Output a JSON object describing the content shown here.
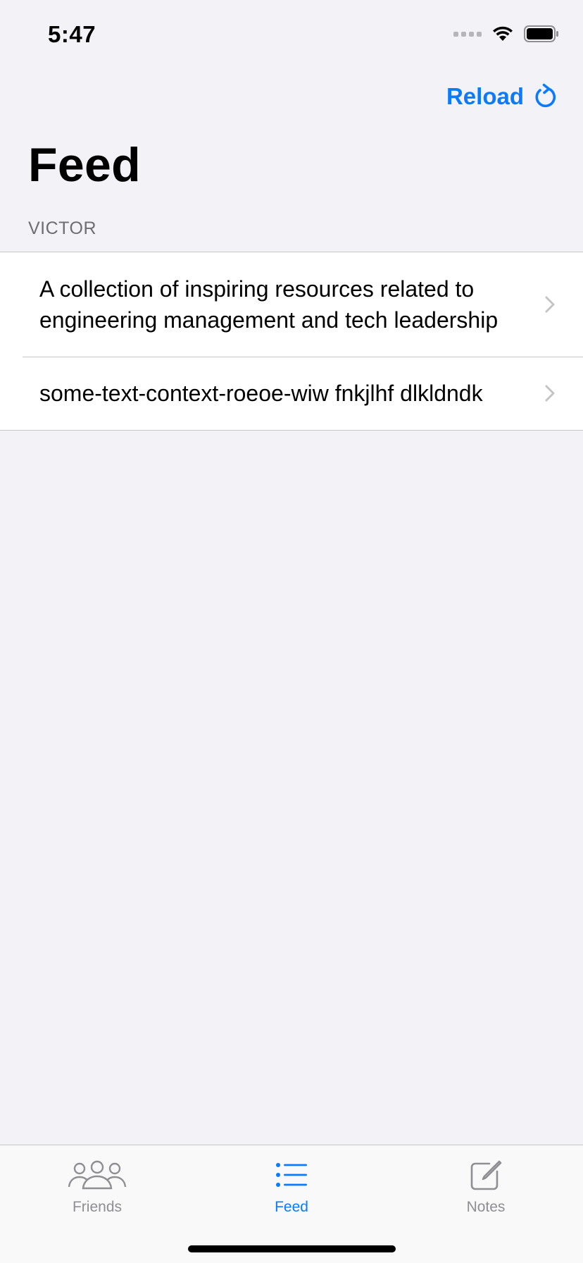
{
  "status_bar": {
    "time": "5:47"
  },
  "nav": {
    "reload_label": "Reload",
    "title": "Feed"
  },
  "section": {
    "header": "VICTOR"
  },
  "items": [
    {
      "label": "A collection of inspiring resources related to engineering management and tech leadership"
    },
    {
      "label": "some-text-context-roeoe-wiw fnkjlhf dlkldndk"
    }
  ],
  "tabs": [
    {
      "label": "Friends",
      "icon": "friends-icon",
      "active": false
    },
    {
      "label": "Feed",
      "icon": "feed-list-icon",
      "active": true
    },
    {
      "label": "Notes",
      "icon": "compose-note-icon",
      "active": false
    }
  ],
  "colors": {
    "accent": "#0a7aff",
    "background": "#f2f2f7",
    "inactive": "#8e8e93"
  }
}
